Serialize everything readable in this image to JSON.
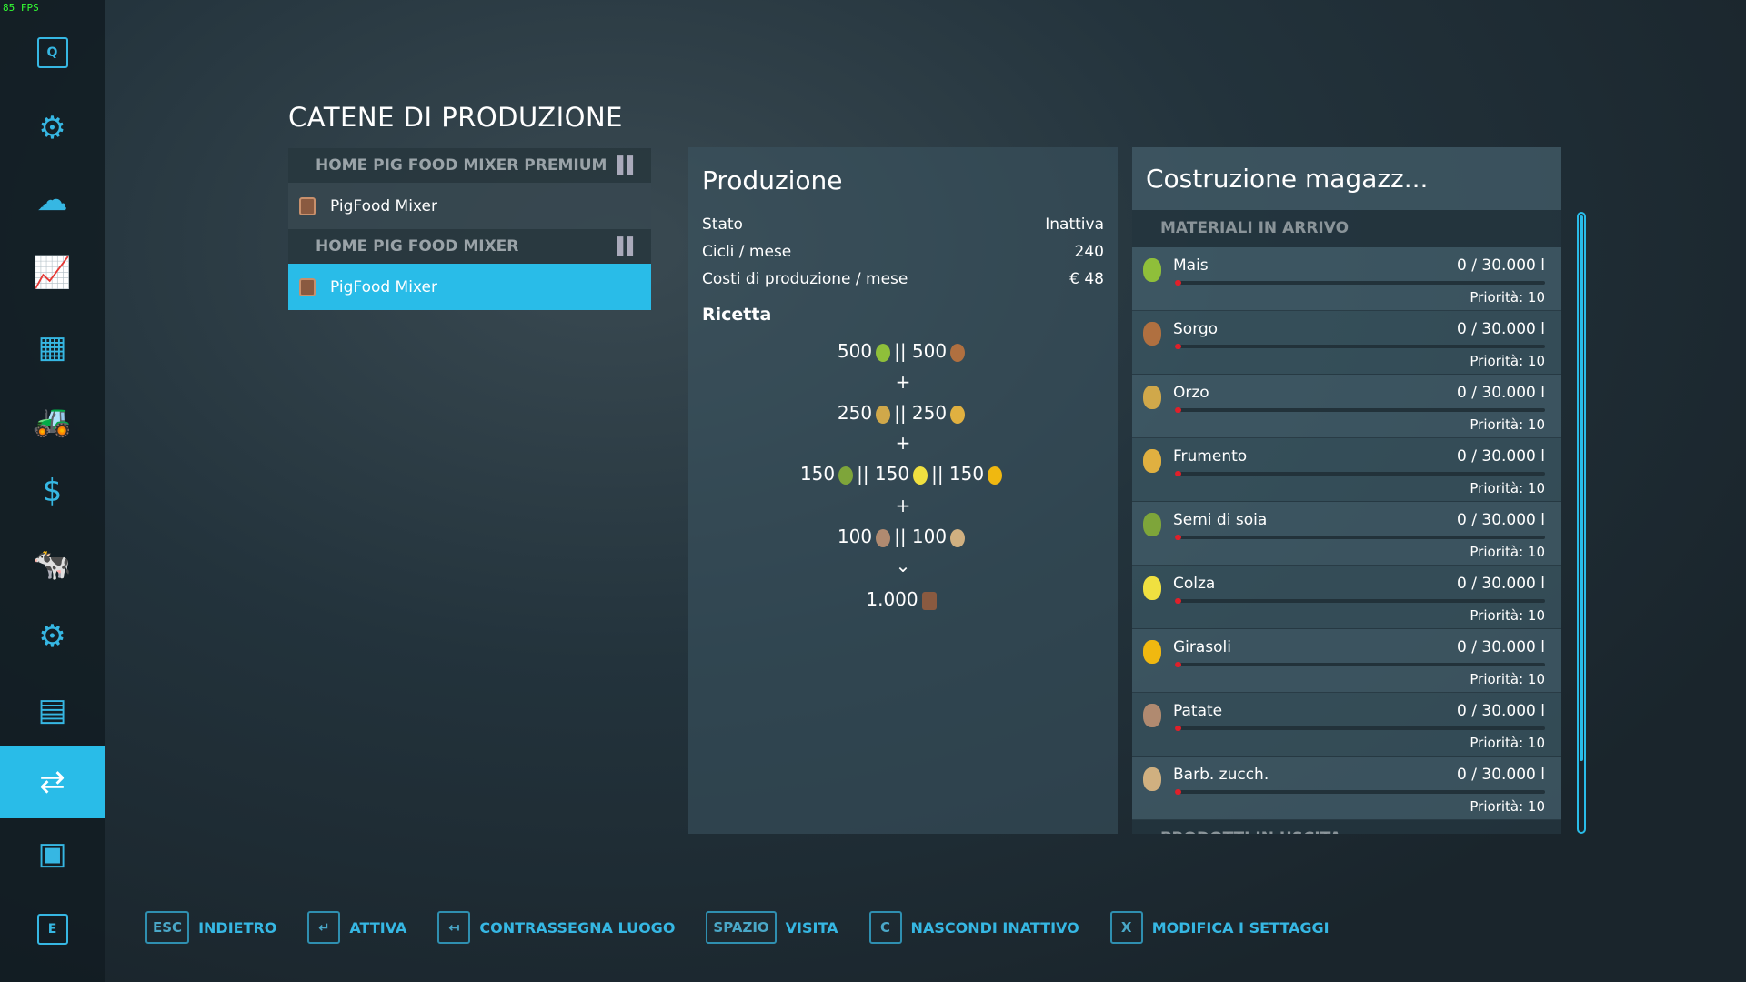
{
  "fps": "85 FPS",
  "sidebar": {
    "items": [
      {
        "icon": "q-key-icon",
        "label": "Q"
      },
      {
        "icon": "gear-icon"
      },
      {
        "icon": "weather-icon"
      },
      {
        "icon": "prices-icon"
      },
      {
        "icon": "statistics-icon"
      },
      {
        "icon": "tractor-icon"
      },
      {
        "icon": "finance-icon"
      },
      {
        "icon": "animals-icon"
      },
      {
        "icon": "contracts-icon"
      },
      {
        "icon": "help-icon"
      },
      {
        "icon": "production-icon",
        "selected": true
      },
      {
        "icon": "tour-icon"
      },
      {
        "icon": "e-key-icon",
        "label": "E"
      }
    ]
  },
  "page_title": "CATENE DI PRODUZIONE",
  "chains": [
    {
      "header": "HOME PIG FOOD MIXER PREMIUM",
      "item": "PigFood Mixer",
      "selected": false
    },
    {
      "header": "HOME PIG FOOD MIXER",
      "item": "PigFood Mixer",
      "selected": true
    }
  ],
  "production": {
    "title": "Produzione",
    "stato_label": "Stato",
    "stato": "Inattiva",
    "cicli_label": "Cicli / mese",
    "cicli": "240",
    "costi_label": "Costi di produzione / mese",
    "costi": "€ 48",
    "ricetta_label": "Ricetta",
    "recipe": [
      "500 [mais] || 500 [sorgo]",
      "+",
      "250 [orzo] || 250 [frumento]",
      "+",
      "150 [soia] || 150 [colza] || 150 [girasoli]",
      "+",
      "100 [patate] || 100 [barbabietole]",
      "⌄",
      "1.000 [pigfood]"
    ],
    "r1a": "500",
    "r1b": "|| 500",
    "r2a": "250",
    "r2b": "|| 250",
    "r3a": "150",
    "r3b": "|| 150",
    "r3c": "|| 150",
    "r4a": "100",
    "r4b": "|| 100",
    "plus": "+",
    "arrow": "⌄",
    "out": "1.000"
  },
  "storage": {
    "title": "Costruzione magazz...",
    "section_in": "MATERIALI IN ARRIVO",
    "section_out": "PRODOTTI IN USCITA",
    "items": [
      {
        "name": "Mais",
        "amount": "0  / 30.000 l",
        "priority": "Priorità: 10",
        "fill": 0,
        "color": "#8fbf3a"
      },
      {
        "name": "Sorgo",
        "amount": "0  / 30.000 l",
        "priority": "Priorità: 10",
        "fill": 0,
        "color": "#b07040"
      },
      {
        "name": "Orzo",
        "amount": "0  / 30.000 l",
        "priority": "Priorità: 10",
        "fill": 0,
        "color": "#d0a84a"
      },
      {
        "name": "Frumento",
        "amount": "0  / 30.000 l",
        "priority": "Priorità: 10",
        "fill": 0,
        "color": "#e0b040"
      },
      {
        "name": "Semi di soia",
        "amount": "0  / 30.000 l",
        "priority": "Priorità: 10",
        "fill": 0,
        "color": "#7ea53a"
      },
      {
        "name": "Colza",
        "amount": "0  / 30.000 l",
        "priority": "Priorità: 10",
        "fill": 0,
        "color": "#f0e040"
      },
      {
        "name": "Girasoli",
        "amount": "0  / 30.000 l",
        "priority": "Priorità: 10",
        "fill": 0,
        "color": "#f0b810"
      },
      {
        "name": "Patate",
        "amount": "0  / 30.000 l",
        "priority": "Priorità: 10",
        "fill": 0,
        "color": "#b08a70"
      },
      {
        "name": "Barb. zucch.",
        "amount": "0  / 30.000 l",
        "priority": "Priorità: 10",
        "fill": 0,
        "color": "#d0b080"
      }
    ]
  },
  "actions": [
    {
      "key": "ESC",
      "label": "INDIETRO"
    },
    {
      "key": "↵",
      "label": "ATTIVA"
    },
    {
      "key": "↤",
      "label": "CONTRASSEGNA LUOGO"
    },
    {
      "key": "SPAZIO",
      "label": "VISITA"
    },
    {
      "key": "C",
      "label": "NASCONDI INATTIVO"
    },
    {
      "key": "X",
      "label": "MODIFICA I SETTAGGI"
    }
  ]
}
